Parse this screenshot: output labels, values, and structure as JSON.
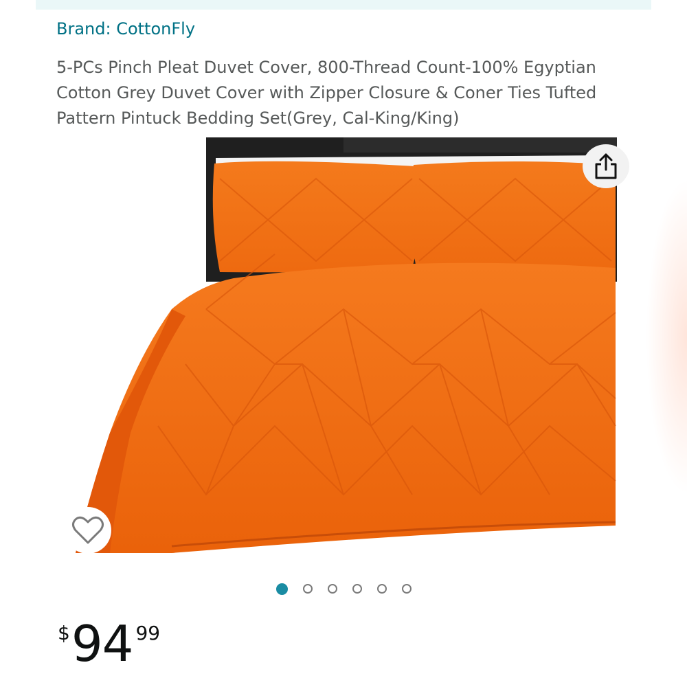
{
  "brand": {
    "label": "Brand: CottonFly"
  },
  "product": {
    "title": "5-PCs Pinch Pleat Duvet Cover, 800-Thread Count-100% Egyptian Cotton Grey Duvet Cover with Zipper Closure & Coner Ties Tufted Pattern Pintuck Bedding Set(Grey, Cal-King/King)"
  },
  "gallery": {
    "image_count": 6,
    "active_index": 0,
    "share_icon": "share-icon",
    "wishlist_icon": "heart-outline-icon"
  },
  "price": {
    "symbol": "$",
    "whole": "94",
    "fraction": "99"
  },
  "colors": {
    "brand_link": "#007185",
    "active_dot": "#1a8ca3",
    "bedding": "#f26b0f"
  }
}
